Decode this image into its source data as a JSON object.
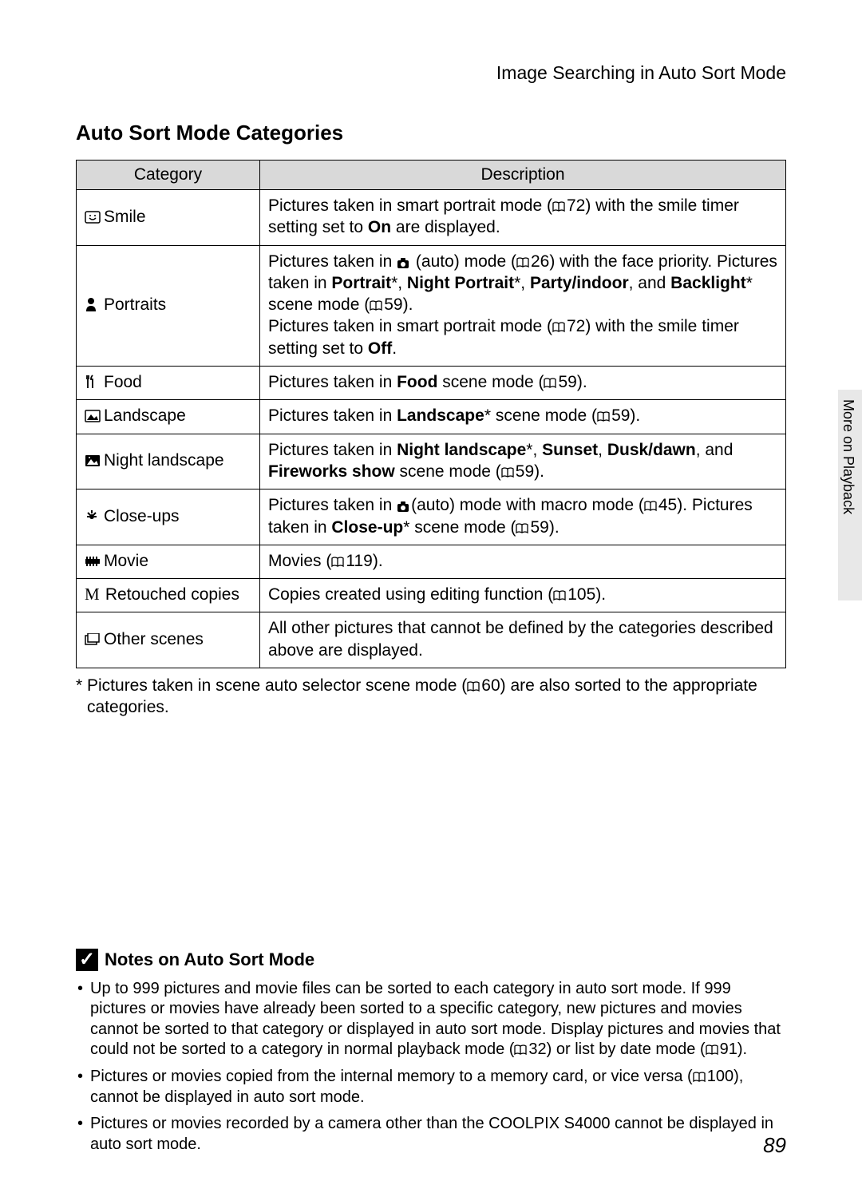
{
  "breadcrumb": "Image Searching in Auto Sort Mode",
  "heading": "Auto Sort Mode Categories",
  "table": {
    "headers": [
      "Category",
      "Description"
    ]
  },
  "rows": {
    "smile": {
      "label": "Smile",
      "d1": "Pictures taken in smart portrait mode (",
      "ref1": "72) with the smile timer setting set to ",
      "b1": "On",
      "d2": " are displayed."
    },
    "portraits": {
      "label": "Portraits",
      "d1": "Pictures taken in ",
      "d2": " (auto) mode (",
      "ref1": "26) with the face priority. Pictures taken in ",
      "b1": "Portrait",
      "s1": "*, ",
      "b2": "Night Portrait",
      "s2": "*, ",
      "b3": "Party/indoor",
      "s3": ", and ",
      "b4": "Backlight",
      "s4": "* scene mode (",
      "ref2": "59).",
      "d3": "Pictures taken in smart portrait mode (",
      "ref3": "72) with the smile timer setting set to ",
      "b5": "Off",
      "d4": "."
    },
    "food": {
      "label": "Food",
      "d1": "Pictures taken in ",
      "b1": "Food",
      "d2": " scene mode (",
      "ref1": "59)."
    },
    "landscape": {
      "label": "Landscape",
      "d1": "Pictures taken in ",
      "b1": "Landscape",
      "d2": "* scene mode (",
      "ref1": "59)."
    },
    "night": {
      "label": "Night landscape",
      "d1": "Pictures taken in ",
      "b1": "Night landscape",
      "s1": "*, ",
      "b2": "Sunset",
      "s2": ", ",
      "b3": "Dusk/dawn",
      "s3": ", and ",
      "b4": "Fireworks show",
      "d2": " scene mode (",
      "ref1": "59)."
    },
    "closeups": {
      "label": "Close-ups",
      "d1": "Pictures taken in ",
      "d2": "(auto) mode with macro mode (",
      "ref1": "45). Pictures taken in ",
      "b1": "Close-up",
      "d3": "* scene mode (",
      "ref2": "59)."
    },
    "movie": {
      "label": "Movie",
      "d1": "Movies (",
      "ref1": "119)."
    },
    "retouched": {
      "iconLetter": "M",
      "label": "Retouched copies",
      "d1": "Copies created using editing function (",
      "ref1": "105)."
    },
    "other": {
      "label": "Other scenes",
      "d1": "All other pictures that cannot be defined by the categories described above are displayed."
    }
  },
  "footnote": {
    "t1": "* Pictures taken in scene auto selector scene mode (",
    "ref1": "60) are also sorted to the appropriate categories."
  },
  "sideTab": "More on Playback",
  "notes": {
    "heading": "Notes on Auto Sort Mode",
    "n1": {
      "t1": "Up to 999 pictures and movie files can be sorted to each category in auto sort mode. If 999 pictures or movies have already been sorted to a specific category, new pictures and movies cannot be sorted to that category or displayed in auto sort mode. Display pictures and movies that could not be sorted to a category in normal playback mode (",
      "r1": "32) or list by date mode (",
      "r2": "91)."
    },
    "n2": {
      "t1": "Pictures or movies copied from the internal memory to a memory card, or vice versa (",
      "r1": "100), cannot be displayed in auto sort mode."
    },
    "n3": {
      "t1": "Pictures or movies recorded by a camera other than the COOLPIX S4000 cannot be displayed in auto sort mode."
    }
  },
  "pageNumber": "89"
}
